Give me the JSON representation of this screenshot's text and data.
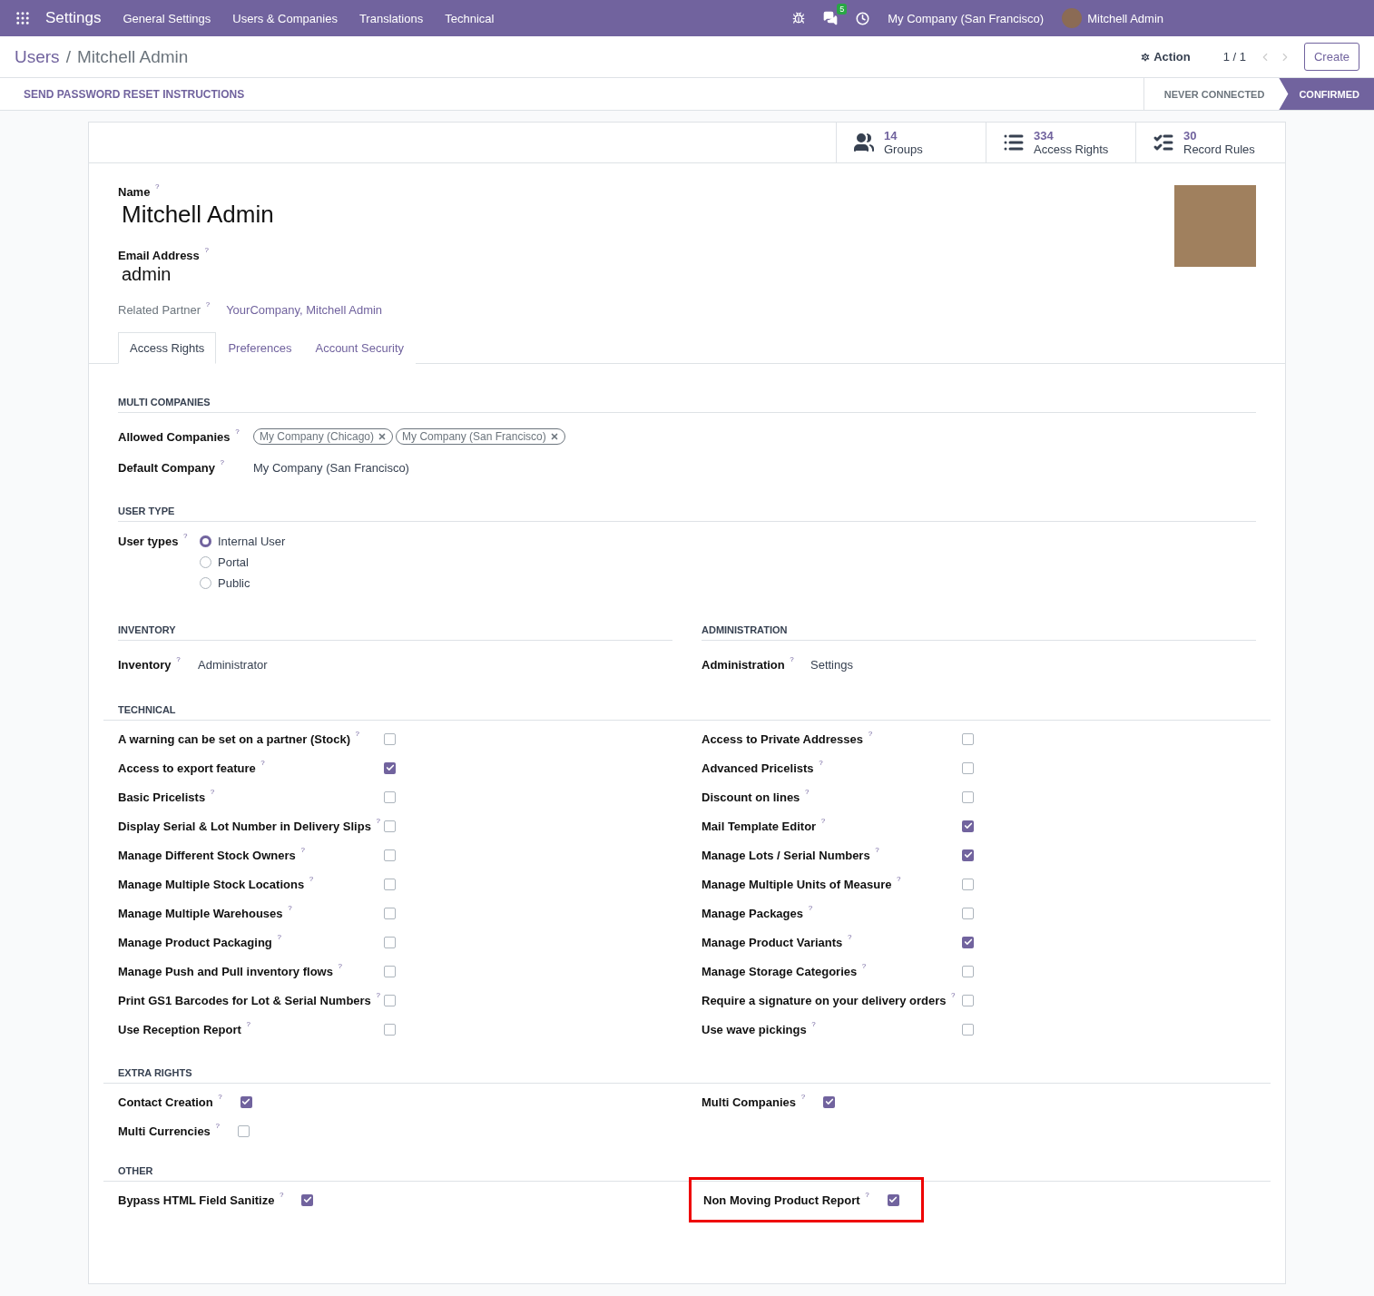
{
  "navbar": {
    "app_name": "Settings",
    "menus": [
      "General Settings",
      "Users & Companies",
      "Translations",
      "Technical"
    ],
    "message_count": "5",
    "company": "My Company (San Francisco)",
    "user": "Mitchell Admin"
  },
  "breadcrumb": {
    "parent": "Users",
    "separator": "/",
    "current": "Mitchell Admin"
  },
  "pager": {
    "action": "Action",
    "value": "1 / 1"
  },
  "create_button": "Create",
  "header_button": "SEND PASSWORD RESET INSTRUCTIONS",
  "statusbar": [
    {
      "label": "NEVER CONNECTED",
      "selected": false
    },
    {
      "label": "CONFIRMED",
      "selected": true
    }
  ],
  "stat_buttons": [
    {
      "kind": "users",
      "value": "14",
      "label": "Groups"
    },
    {
      "kind": "list",
      "value": "334",
      "label": "Access Rights"
    },
    {
      "kind": "bullets",
      "value": "30",
      "label": "Record Rules"
    }
  ],
  "name": {
    "label": "Name $^{?}$",
    "value": "Mitchell Admin"
  },
  "email": {
    "label": "Email Address $^{?}$",
    "value": "admin"
  },
  "related_partner": {
    "label": "Related Partner $^{?}$",
    "value": "YourCompany, Mitchell Admin"
  },
  "tabs": [
    {
      "label": "Access Rights",
      "selected": true
    },
    {
      "label": "Preferences",
      "selected": false
    },
    {
      "label": "Account Security",
      "selected": false
    }
  ],
  "multi_companies": {
    "title": "MULTI COMPANIES",
    "allowed_label": "Allowed Companies $^{?}$",
    "allowed": [
      "My Company (Chicago)",
      "My Company (San Francisco)"
    ],
    "default_label": "Default Company $^{?}$",
    "default": "My Company (San Francisco)"
  },
  "user_type": {
    "title": "USER TYPE",
    "label": "User types $^{?}$",
    "options": [
      {
        "label": "Internal User",
        "selected": true
      },
      {
        "label": "Portal",
        "selected": false
      },
      {
        "label": "Public",
        "selected": false
      }
    ]
  },
  "selections": [
    {
      "title": "INVENTORY",
      "label": "Inventory $^{?}$",
      "value": "Administrator"
    },
    {
      "title": "ADMINISTRATION",
      "label": "Administration $^{?}$",
      "value": "Settings"
    }
  ],
  "checkbox_sections": [
    {
      "title": "TECHNICAL",
      "kind": "grid",
      "left": [
        {
          "label": "A warning can be set on a partner (Stock) $^{?}$",
          "checked": false
        },
        {
          "label": "Access to export feature $^{?}$",
          "checked": true
        },
        {
          "label": "Basic Pricelists $^{?}$",
          "checked": false
        },
        {
          "label": "Display Serial & Lot Number in Delivery Slips $^{?}$",
          "checked": false
        },
        {
          "label": "Manage Different Stock Owners $^{?}$",
          "checked": false
        },
        {
          "label": "Manage Multiple Stock Locations $^{?}$",
          "checked": false
        },
        {
          "label": "Manage Multiple Warehouses $^{?}$",
          "checked": false
        },
        {
          "label": "Manage Product Packaging $^{?}$",
          "checked": false
        },
        {
          "label": "Manage Push and Pull inventory flows $^{?}$",
          "checked": false
        },
        {
          "label": "Print GS1 Barcodes for Lot & Serial Numbers $^{?}$",
          "checked": false
        },
        {
          "label": "Use Reception Report $^{?}$",
          "checked": false
        }
      ],
      "right": [
        {
          "label": "Access to Private Addresses $^{?}$",
          "checked": false
        },
        {
          "label": "Advanced Pricelists $^{?}$",
          "checked": false
        },
        {
          "label": "Discount on lines $^{?}$",
          "checked": false
        },
        {
          "label": "Mail Template Editor $^{?}$",
          "checked": true
        },
        {
          "label": "Manage Lots / Serial Numbers $^{?}$",
          "checked": true
        },
        {
          "label": "Manage Multiple Units of Measure $^{?}$",
          "checked": false
        },
        {
          "label": "Manage Packages $^{?}$",
          "checked": false
        },
        {
          "label": "Manage Product Variants $^{?}$",
          "checked": true
        },
        {
          "label": "Manage Storage Categories $^{?}$",
          "checked": false
        },
        {
          "label": "Require a signature on your delivery orders $^{?}$",
          "checked": false
        },
        {
          "label": "Use wave pickings $^{?}$",
          "checked": false
        }
      ]
    },
    {
      "title": "EXTRA RIGHTS",
      "kind": "inline",
      "left": [
        {
          "label": "Contact Creation $^{?}$",
          "checked": true
        },
        {
          "label": "Multi Currencies $^{?}$",
          "checked": false
        }
      ],
      "right": [
        {
          "label": "Multi Companies $^{?}$",
          "checked": true
        }
      ]
    },
    {
      "title": "OTHER",
      "kind": "inline",
      "left": [
        {
          "label": "Bypass HTML Field Sanitize $^{?}$",
          "checked": true
        }
      ],
      "right": [
        {
          "label": "Non Moving Product Report $^{?}$",
          "checked": true,
          "highlighted": true
        }
      ]
    }
  ]
}
